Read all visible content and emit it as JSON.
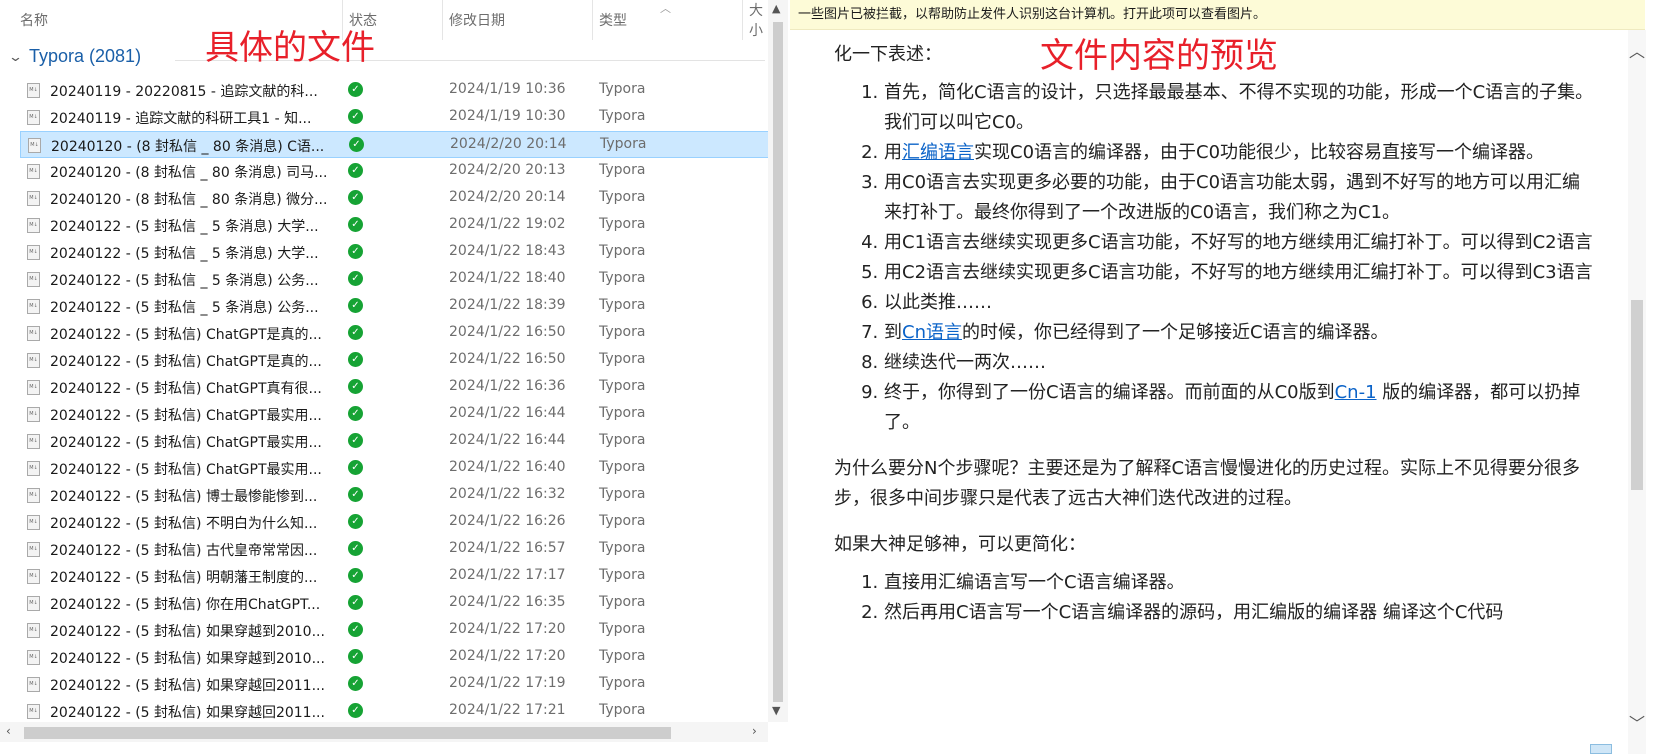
{
  "explorer": {
    "columns": {
      "name": "名称",
      "status": "状态",
      "date": "修改日期",
      "type": "类型",
      "size": "大小"
    },
    "group": {
      "label": "Typora (2081)"
    },
    "files": [
      {
        "name": "20240119 - 20220815 - 追踪文献的科...",
        "date": "2024/1/19 10:36",
        "type": "Typora",
        "selected": false
      },
      {
        "name": "20240119 - 追踪文献的科研工具1 - 知...",
        "date": "2024/1/19 10:30",
        "type": "Typora",
        "selected": false
      },
      {
        "name": "20240120 - (8 封私信 _ 80 条消息) C语...",
        "date": "2024/2/20 20:14",
        "type": "Typora",
        "selected": true
      },
      {
        "name": "20240120 - (8 封私信 _ 80 条消息) 司马...",
        "date": "2024/2/20 20:13",
        "type": "Typora",
        "selected": false
      },
      {
        "name": "20240120 - (8 封私信 _ 80 条消息) 微分...",
        "date": "2024/2/20 20:14",
        "type": "Typora",
        "selected": false
      },
      {
        "name": "20240122 - (5 封私信 _ 5 条消息) 大学...",
        "date": "2024/1/22 19:02",
        "type": "Typora",
        "selected": false
      },
      {
        "name": "20240122 - (5 封私信 _ 5 条消息) 大学...",
        "date": "2024/1/22 18:43",
        "type": "Typora",
        "selected": false
      },
      {
        "name": "20240122 - (5 封私信 _ 5 条消息) 公务...",
        "date": "2024/1/22 18:40",
        "type": "Typora",
        "selected": false
      },
      {
        "name": "20240122 - (5 封私信 _ 5 条消息) 公务...",
        "date": "2024/1/22 18:39",
        "type": "Typora",
        "selected": false
      },
      {
        "name": "20240122 - (5 封私信) ChatGPT是真的...",
        "date": "2024/1/22 16:50",
        "type": "Typora",
        "selected": false
      },
      {
        "name": "20240122 - (5 封私信) ChatGPT是真的...",
        "date": "2024/1/22 16:50",
        "type": "Typora",
        "selected": false
      },
      {
        "name": "20240122 - (5 封私信) ChatGPT真有很...",
        "date": "2024/1/22 16:36",
        "type": "Typora",
        "selected": false
      },
      {
        "name": "20240122 - (5 封私信) ChatGPT最实用...",
        "date": "2024/1/22 16:44",
        "type": "Typora",
        "selected": false
      },
      {
        "name": "20240122 - (5 封私信) ChatGPT最实用...",
        "date": "2024/1/22 16:44",
        "type": "Typora",
        "selected": false
      },
      {
        "name": "20240122 - (5 封私信) ChatGPT最实用...",
        "date": "2024/1/22 16:40",
        "type": "Typora",
        "selected": false
      },
      {
        "name": "20240122 - (5 封私信) 博士最惨能惨到...",
        "date": "2024/1/22 16:32",
        "type": "Typora",
        "selected": false
      },
      {
        "name": "20240122 - (5 封私信) 不明白为什么知...",
        "date": "2024/1/22 16:26",
        "type": "Typora",
        "selected": false
      },
      {
        "name": "20240122 - (5 封私信) 古代皇帝常常因...",
        "date": "2024/1/22 16:57",
        "type": "Typora",
        "selected": false
      },
      {
        "name": "20240122 - (5 封私信) 明朝藩王制度的...",
        "date": "2024/1/22 17:17",
        "type": "Typora",
        "selected": false
      },
      {
        "name": "20240122 - (5 封私信) 你在用ChatGPT...",
        "date": "2024/1/22 16:35",
        "type": "Typora",
        "selected": false
      },
      {
        "name": "20240122 - (5 封私信) 如果穿越到2010...",
        "date": "2024/1/22 17:20",
        "type": "Typora",
        "selected": false
      },
      {
        "name": "20240122 - (5 封私信) 如果穿越到2010...",
        "date": "2024/1/22 17:20",
        "type": "Typora",
        "selected": false
      },
      {
        "name": "20240122 - (5 封私信) 如果穿越回2011...",
        "date": "2024/1/22 17:19",
        "type": "Typora",
        "selected": false
      },
      {
        "name": "20240122 - (5 封私信) 如果穿越回2011...",
        "date": "2024/1/22 17:21",
        "type": "Typora",
        "selected": false
      }
    ],
    "status_icon": "green-check-icon",
    "file_icon_text": "M↓"
  },
  "annotations": {
    "left": "具体的文件",
    "right": "文件内容的预览"
  },
  "preview": {
    "info_bar": "一些图片已被拦截，以帮助防止发件人识别这台计算机。打开此项可以查看图片。",
    "intro_tail": "化一下表述：",
    "steps": [
      {
        "before": "首先，简化C语言的设计，只选择最最基本、不得不实现的功能，形成一个C语言的子集。我们可以叫它C0。",
        "link": "",
        "after": ""
      },
      {
        "before": "用",
        "link": "汇编语言",
        "after": "实现C0语言的编译器，由于C0功能很少，比较容易直接写一个编译器。"
      },
      {
        "before": "用C0语言去实现更多必要的功能，由于C0语言功能太弱，遇到不好写的地方可以用汇编来打补丁。最终你得到了一个改进版的C0语言，我们称之为C1。",
        "link": "",
        "after": ""
      },
      {
        "before": "用C1语言去继续实现更多C语言功能，不好写的地方继续用汇编打补丁。可以得到C2语言",
        "link": "",
        "after": ""
      },
      {
        "before": "用C2语言去继续实现更多C语言功能，不好写的地方继续用汇编打补丁。可以得到C3语言",
        "link": "",
        "after": ""
      },
      {
        "before": "以此类推……",
        "link": "",
        "after": ""
      },
      {
        "before": "到",
        "link": "Cn语言",
        "after": "的时候，你已经得到了一个足够接近C语言的编译器。"
      },
      {
        "before": "继续迭代一两次……",
        "link": "",
        "after": ""
      },
      {
        "before": "终于，你得到了一份C语言的编译器。而前面的从C0版到",
        "link": "Cn-1",
        "after": " 版的编译器，都可以扔掉了。"
      }
    ],
    "para1": "为什么要分N个步骤呢？主要还是为了解释C语言慢慢进化的历史过程。实际上不见得要分很多步，很多中间步骤只是代表了远古大神们迭代改进的过程。",
    "para2": "如果大神足够神，可以更简化：",
    "steps2": [
      "直接用汇编语言写一个C语言编译器。",
      "然后再用C语言写一个C语言编译器的源码，用汇编版的编译器 编译这个C代码"
    ]
  }
}
